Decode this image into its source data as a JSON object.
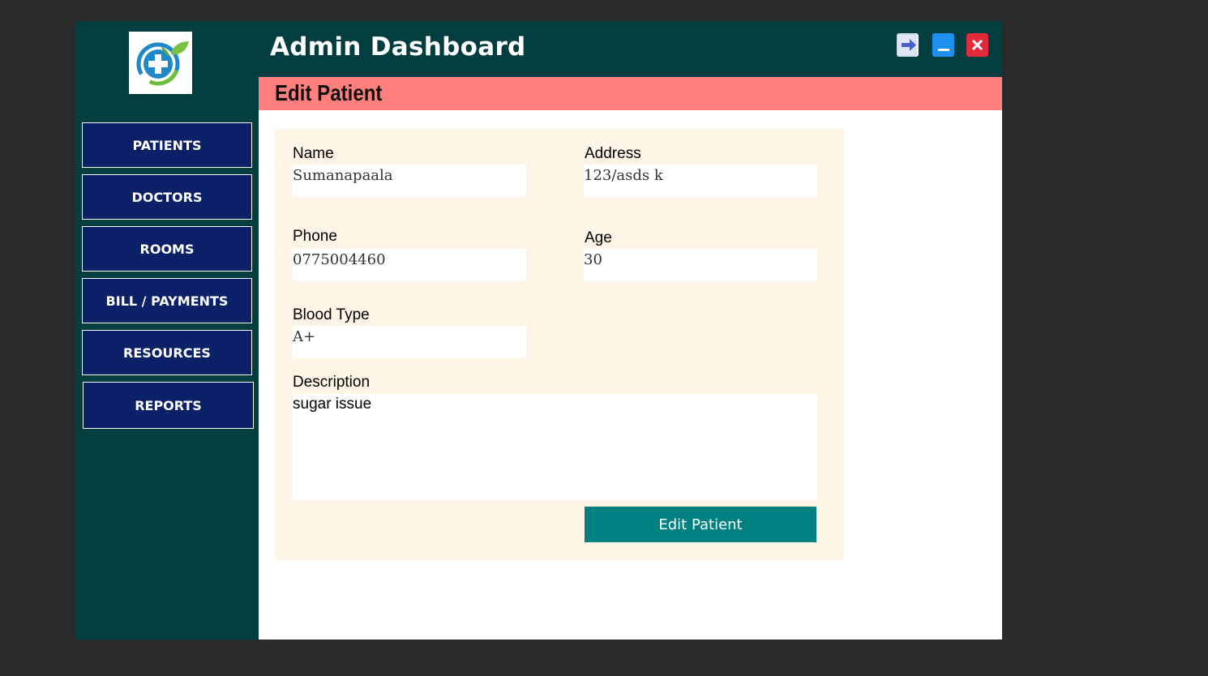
{
  "header": {
    "title": "Admin Dashboard",
    "window_buttons": [
      {
        "icon": "logout-arrow-icon",
        "color": "#e8eef8",
        "accent": "#4a5fc9"
      },
      {
        "icon": "minimize-icon",
        "color": "#1e90f0"
      },
      {
        "icon": "close-icon",
        "color": "#e02b3b"
      }
    ]
  },
  "sidebar": {
    "logo_icon": "medical-cross-leaf-logo",
    "items": [
      {
        "label": "PATIENTS"
      },
      {
        "label": "DOCTORS"
      },
      {
        "label": "ROOMS"
      },
      {
        "label": "BILL / PAYMENTS"
      },
      {
        "label": "RESOURCES"
      },
      {
        "label": "REPORTS"
      }
    ]
  },
  "page": {
    "title": "Edit Patient"
  },
  "form": {
    "name": {
      "label": "Name",
      "value": "Sumanapaala"
    },
    "address": {
      "label": "Address",
      "value": "123/asds k"
    },
    "phone": {
      "label": "Phone",
      "value": "0775004460"
    },
    "age": {
      "label": "Age",
      "value": "30"
    },
    "blood_type": {
      "label": "Blood Type",
      "value": "A+"
    },
    "description": {
      "label": "Description",
      "value": "sugar issue"
    },
    "submit_label": "Edit Patient"
  },
  "colors": {
    "sidebar_bg": "#023d40",
    "nav_button_bg": "#0b2066",
    "subheader_bg": "#ff807d",
    "form_panel_bg": "#fdf5e6",
    "submit_bg": "#008080"
  }
}
